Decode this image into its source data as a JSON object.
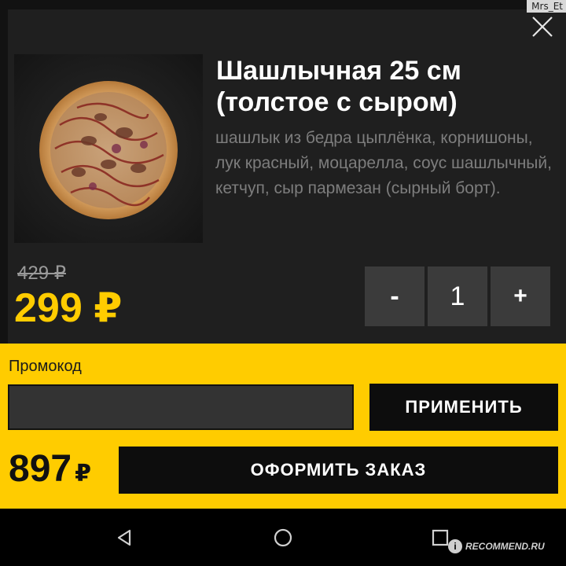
{
  "watermark_user": "Mrs_Et",
  "product": {
    "title": "Шашлычная 25 см (толстое с сыром)",
    "description": "шашлык из бедра цыплёнка, корнишоны, лук красный, моцарелла, соус шашлычный, кетчуп, сыр пармезан (сырный борт).",
    "old_price": "429 ₽",
    "price": "299 ₽",
    "image_icon": "pizza-image"
  },
  "quantity": {
    "minus_label": "-",
    "value": "1",
    "plus_label": "+"
  },
  "promo": {
    "label": "Промокод",
    "value": "",
    "placeholder": "",
    "apply_label": "ПРИМЕНИТЬ"
  },
  "order": {
    "total_amount": "897",
    "total_currency": "₽",
    "checkout_label": "ОФОРМИТЬ ЗАКАЗ"
  },
  "watermark_site": {
    "badge": "i",
    "text": "RECOMMEND.RU"
  },
  "colors": {
    "accent": "#ffcc00",
    "card": "#1f1f1f",
    "button_dark": "#0d0d0d",
    "qty_button": "#3b3b3b"
  }
}
